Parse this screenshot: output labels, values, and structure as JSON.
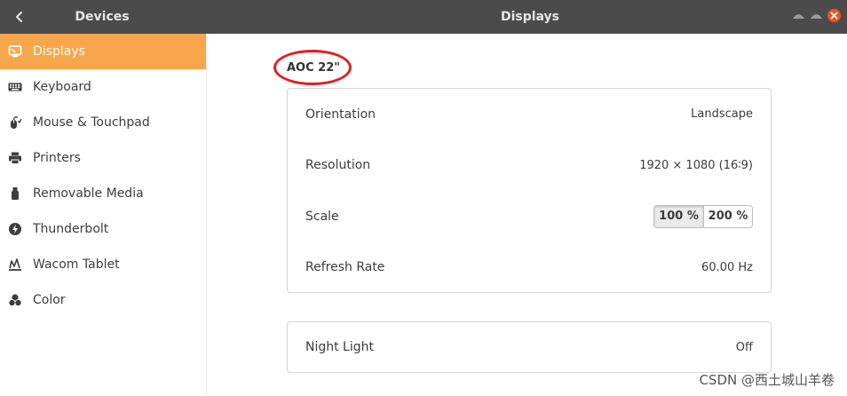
{
  "header": {
    "back_icon": "chevron-left-icon",
    "panel_title": "Devices",
    "page_title": "Displays",
    "window_controls": [
      "minimize-icon",
      "maximize-icon",
      "close-icon"
    ],
    "close_color": "#e95420"
  },
  "sidebar": {
    "accent": "#f8a64b",
    "items": [
      {
        "label": "Displays",
        "icon": "display-icon",
        "active": true
      },
      {
        "label": "Keyboard",
        "icon": "keyboard-icon"
      },
      {
        "label": "Mouse & Touchpad",
        "icon": "mouse-icon"
      },
      {
        "label": "Printers",
        "icon": "printer-icon"
      },
      {
        "label": "Removable Media",
        "icon": "usb-drive-icon"
      },
      {
        "label": "Thunderbolt",
        "icon": "thunderbolt-icon"
      },
      {
        "label": "Wacom Tablet",
        "icon": "tablet-icon"
      },
      {
        "label": "Color",
        "icon": "color-icon"
      }
    ]
  },
  "display": {
    "name": "AOC 22\"",
    "settings": {
      "orientation": {
        "label": "Orientation",
        "value": "Landscape"
      },
      "resolution": {
        "label": "Resolution",
        "value": "1920 × 1080 (16∶9)"
      },
      "scale": {
        "label": "Scale",
        "options": [
          "100 %",
          "200 %"
        ],
        "selected": "100 %"
      },
      "refresh_rate": {
        "label": "Refresh Rate",
        "value": "60.00 Hz"
      }
    },
    "night_light": {
      "label": "Night Light",
      "value": "Off"
    }
  },
  "watermark": "CSDN @西土城山羊卷"
}
